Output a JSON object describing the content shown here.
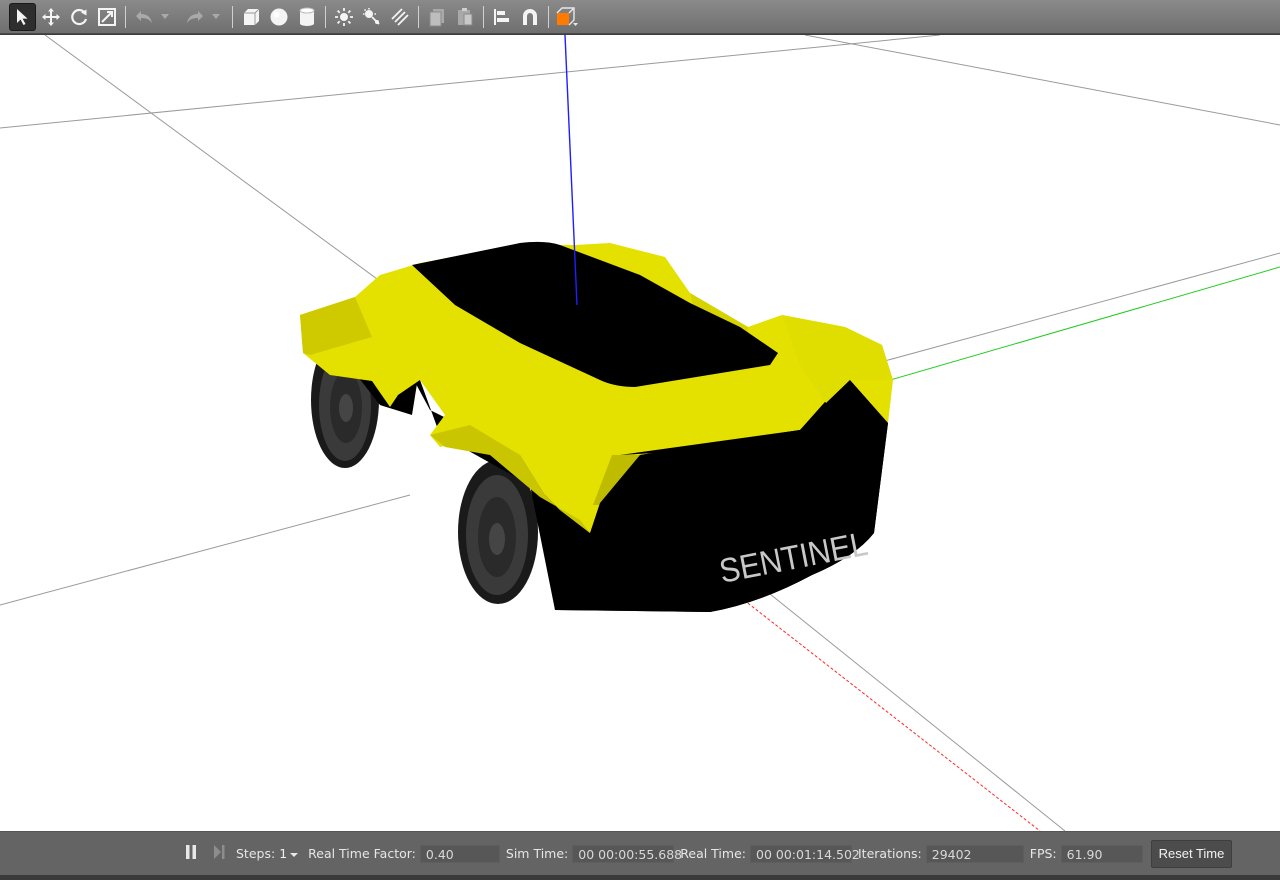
{
  "toolbar": {
    "tools": [
      {
        "name": "select-mode-icon",
        "active": true
      },
      {
        "name": "translate-mode-icon"
      },
      {
        "name": "rotate-mode-icon"
      },
      {
        "name": "scale-mode-icon"
      },
      {
        "name": "undo-icon"
      },
      {
        "name": "undo-history-icon"
      },
      {
        "name": "redo-icon"
      },
      {
        "name": "redo-history-icon"
      },
      {
        "name": "box-shape-icon"
      },
      {
        "name": "sphere-shape-icon"
      },
      {
        "name": "cylinder-shape-icon"
      },
      {
        "name": "point-light-icon"
      },
      {
        "name": "spot-light-icon"
      },
      {
        "name": "directional-light-icon"
      },
      {
        "name": "copy-icon"
      },
      {
        "name": "paste-icon"
      },
      {
        "name": "align-icon"
      },
      {
        "name": "snap-icon"
      },
      {
        "name": "view-angle-icon"
      }
    ]
  },
  "scene": {
    "model_label": "SENTINEL",
    "colors": {
      "body_yellow": "#e4e100",
      "body_black": "#000000",
      "wheel": "#2f2f2f",
      "axis_x": "#ff0000",
      "axis_y": "#00cc00",
      "axis_z": "#0000ff",
      "grid": "#9a9a9a"
    }
  },
  "statusbar": {
    "steps_label": "Steps:",
    "steps_value": "1",
    "real_time_factor_label": "Real Time Factor:",
    "real_time_factor": "0.40",
    "sim_time_label": "Sim Time:",
    "sim_time": "00 00:00:55.688",
    "real_time_label": "Real Time:",
    "real_time": "00 00:01:14.502",
    "iterations_label": "Iterations:",
    "iterations": "29402",
    "fps_label": "FPS:",
    "fps": "61.90",
    "reset_time_label": "Reset Time"
  }
}
